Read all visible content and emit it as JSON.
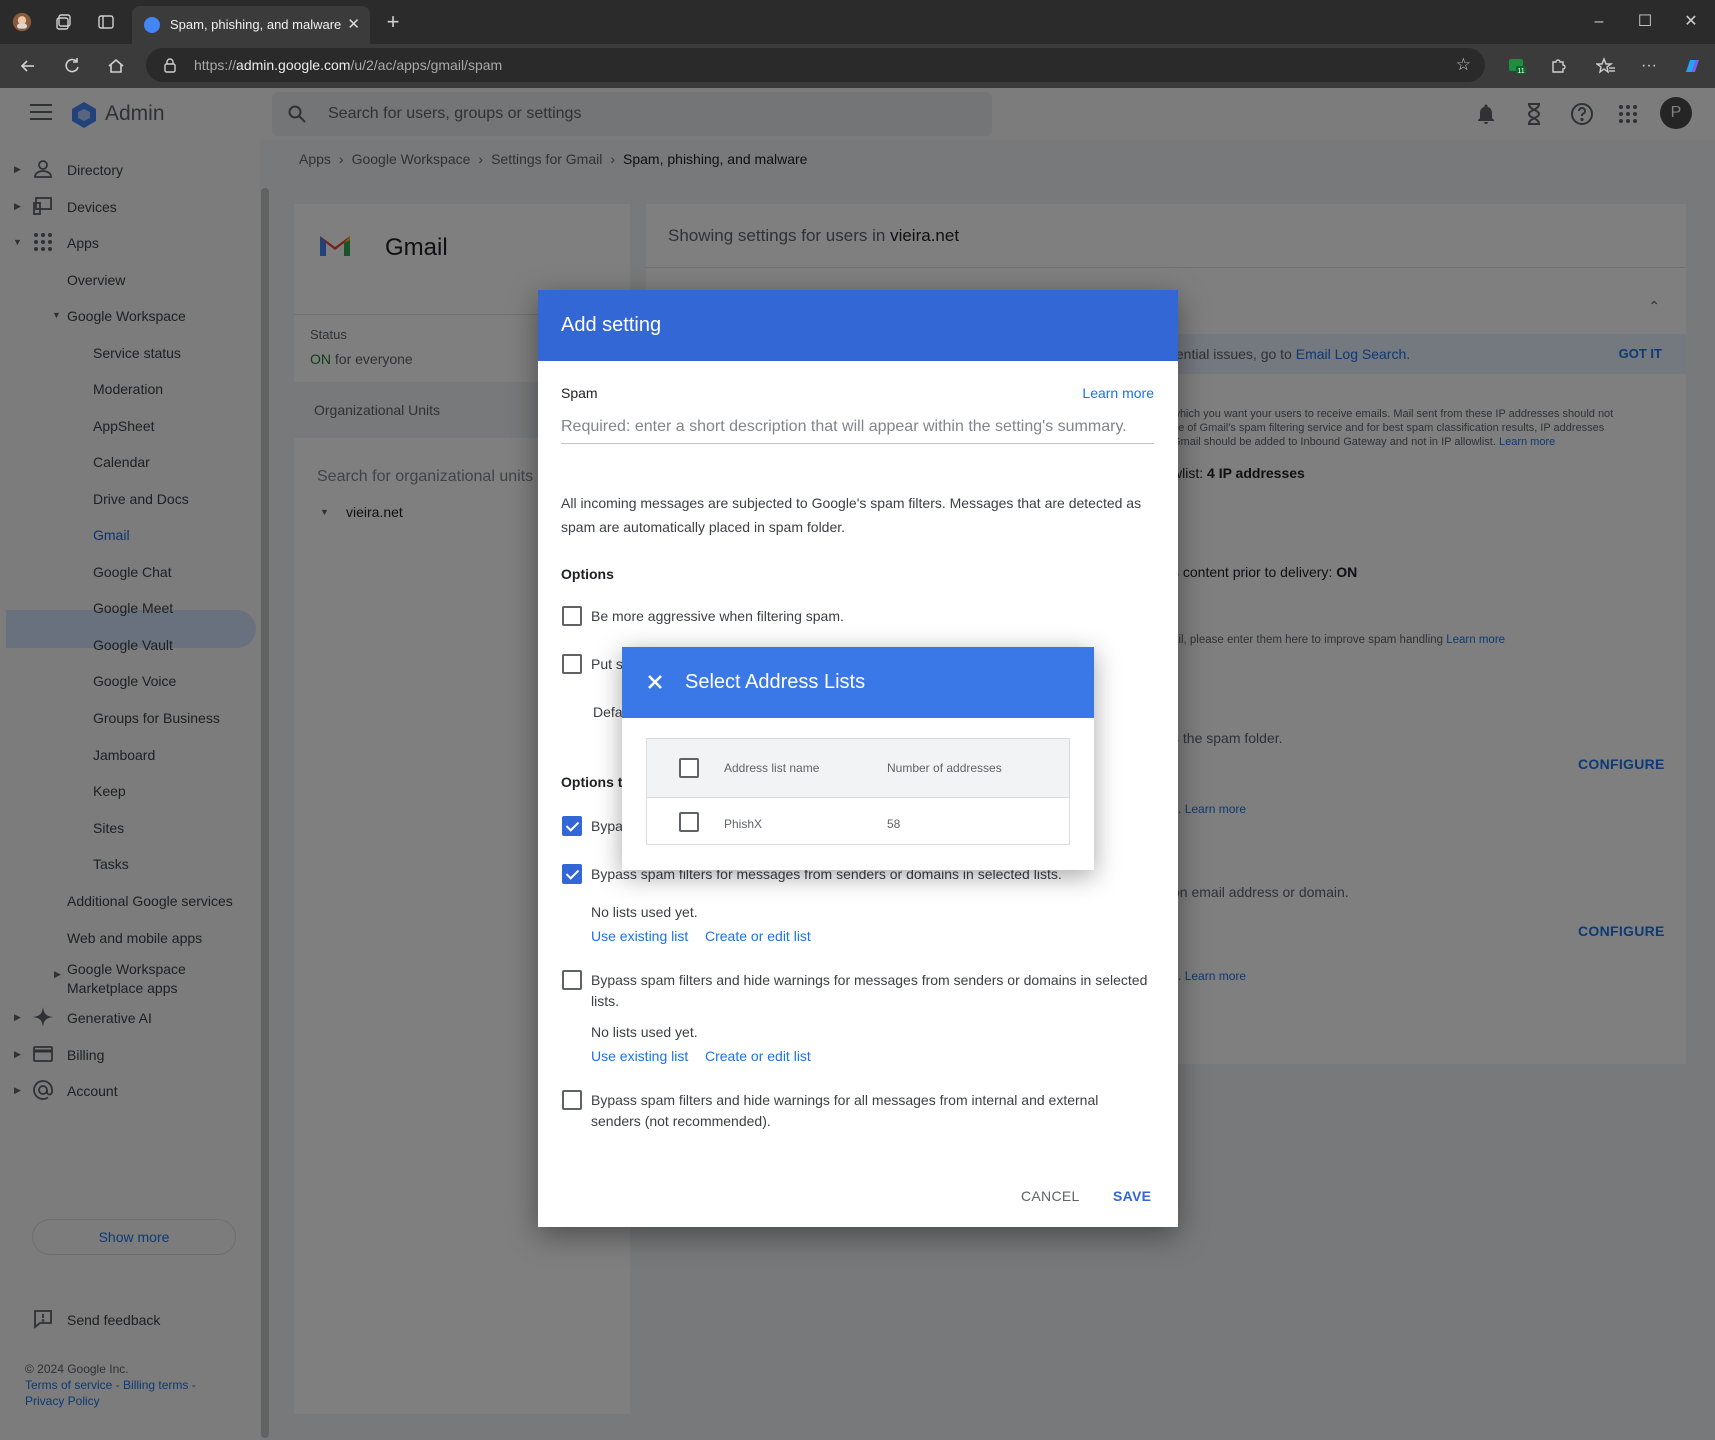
{
  "browser": {
    "tab_title": "Spam, phishing, and malware",
    "url_prefix": "https://",
    "url_host": "admin.google.com",
    "url_path": "/u/2/ac/apps/gmail/spam",
    "extension_badge": "11"
  },
  "admin": {
    "logo_text": "Admin",
    "search_placeholder": "Search for users, groups or settings",
    "avatar_initial": "P"
  },
  "sidebar": {
    "items": {
      "directory": "Directory",
      "devices": "Devices",
      "apps": "Apps",
      "overview": "Overview",
      "google_workspace": "Google Workspace",
      "service_status": "Service status",
      "moderation": "Moderation",
      "appsheet": "AppSheet",
      "calendar": "Calendar",
      "drive_docs": "Drive and Docs",
      "gmail": "Gmail",
      "google_chat": "Google Chat",
      "google_meet": "Google Meet",
      "google_vault": "Google Vault",
      "google_voice": "Google Voice",
      "groups_business": "Groups for Business",
      "jamboard": "Jamboard",
      "keep": "Keep",
      "sites": "Sites",
      "tasks": "Tasks",
      "additional_services": "Additional Google services",
      "web_mobile": "Web and mobile apps",
      "marketplace_1": "Google Workspace",
      "marketplace_2": "Marketplace apps",
      "generative_ai": "Generative AI",
      "billing": "Billing",
      "account": "Account"
    },
    "show_more": "Show more",
    "send_feedback": "Send feedback",
    "copyright": "© 2024 Google Inc.",
    "terms": "Terms of service",
    "billing_terms": "Billing terms",
    "privacy": "Privacy Policy"
  },
  "breadcrumb": [
    "Apps",
    "Google Workspace",
    "Settings for Gmail",
    "Spam, phishing, and malware"
  ],
  "gmail_card": {
    "title": "Gmail",
    "status_label": "Status",
    "status_on": "ON",
    "status_scope": "for everyone",
    "ou_label": "Organizational Units",
    "ou_search_placeholder": "Search for organizational units",
    "ou_root": "vieira.net"
  },
  "right_panel": {
    "showing_prefix": "Showing settings for users in",
    "domain": "vieira.net",
    "banner_text": "tential issues, go to",
    "banner_link": "Email Log Search.",
    "got_it": "GOT IT",
    "allowlist_line1": "which you want your users to receive emails. Mail sent from these IP addresses should not",
    "allowlist_line2": "ge of Gmail's spam filtering service and for best spam classification results, IP addresses",
    "allowlist_line3": "Gmail should be added to Inbound Gateway and not in IP allowlist.",
    "learn_more": "Learn more",
    "allowlist_summary_prefix": "wlist:",
    "allowlist_summary_value": "4 IP addresses",
    "scan_prefix": "s content prior to delivery:",
    "scan_value": "ON",
    "spam_handling_text": "ail, please enter them here to improve spam handling",
    "spam_folder_text": "s the spam folder.",
    "configure": "CONFIGURE",
    "partial_learn_more_1": "s.",
    "partial_g": "g",
    "email_domain_text": "on email address or domain."
  },
  "add_setting": {
    "title": "Add setting",
    "section": "Spam",
    "learn_more": "Learn more",
    "description_placeholder": "Required: enter a short description that will appear within the setting's summary.",
    "intro_line1": "All incoming messages are subjected to Google's spam filters. Messages that are detected as",
    "intro_line2": "spam are automatically placed in spam folder.",
    "options_label": "Options",
    "opt_aggressive": "Be more aggressive when filtering spam.",
    "opt_put_partial": "Put s",
    "default_partial": "Defa",
    "options_to_partial": "Options t",
    "bypass_partial": "Bypa",
    "opt_bypass_selected": "Bypass spam filters for messages from senders or domains in selected lists.",
    "no_lists": "No lists used yet.",
    "use_existing": "Use existing list",
    "create_edit": "Create or edit list",
    "opt_bypass_hide_line1": "Bypass spam filters and hide warnings for messages from senders or domains in selected",
    "opt_bypass_hide_line2": "lists.",
    "opt_bypass_all_line1": "Bypass spam filters and hide warnings for all messages from internal and external",
    "opt_bypass_all_line2": "senders (not recommended).",
    "cancel": "CANCEL",
    "save": "SAVE"
  },
  "select_lists": {
    "title": "Select Address Lists",
    "columns": [
      "Address list name",
      "Number of addresses"
    ],
    "rows": [
      {
        "name": "PhishX",
        "count": "58"
      }
    ]
  },
  "colors": {
    "dialog_header": "#3367d6",
    "select_header": "#3b78e7",
    "link": "#1a73e8"
  }
}
